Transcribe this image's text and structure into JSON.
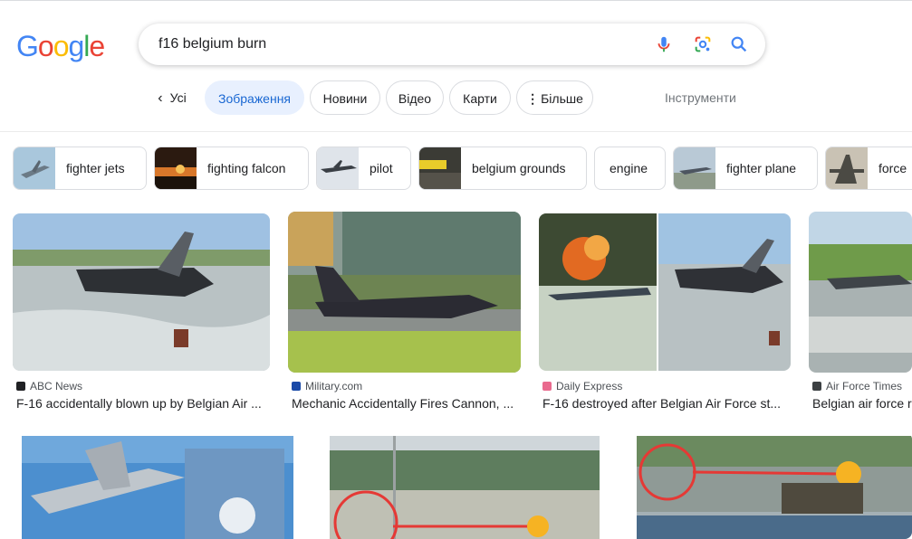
{
  "logo": {
    "letters": [
      "G",
      "o",
      "o",
      "g",
      "l",
      "e"
    ],
    "colors": [
      "#4285f4",
      "#ea4335",
      "#fbbc05",
      "#4285f4",
      "#34a853",
      "#ea4335"
    ]
  },
  "search": {
    "query": "f16 belgium burn"
  },
  "icons": {
    "mic": "microphone-icon",
    "lens": "google-lens-icon",
    "search": "search-icon"
  },
  "tabs": {
    "back": "Усі",
    "images": "Зображення",
    "news": "Новини",
    "video": "Відео",
    "maps": "Карти",
    "more": "Більше",
    "tools": "Інструменти"
  },
  "chips": [
    {
      "label": "fighter jets"
    },
    {
      "label": "fighting falcon"
    },
    {
      "label": "pilot"
    },
    {
      "label": "belgium grounds"
    },
    {
      "label": "engine"
    },
    {
      "label": "fighter plane"
    },
    {
      "label": "force"
    }
  ],
  "results": [
    {
      "source": "ABC News",
      "title": "F-16 accidentally blown up by Belgian Air ..."
    },
    {
      "source": "Military.com",
      "title": "Mechanic Accidentally Fires Cannon, ..."
    },
    {
      "source": "Daily Express",
      "title": "F-16 destroyed after Belgian Air Force st..."
    },
    {
      "source": "Air Force Times",
      "title": "Belgian air force r"
    }
  ],
  "colors": {
    "accent": "#1967d2",
    "active_tab_bg": "#e8f0fe"
  }
}
